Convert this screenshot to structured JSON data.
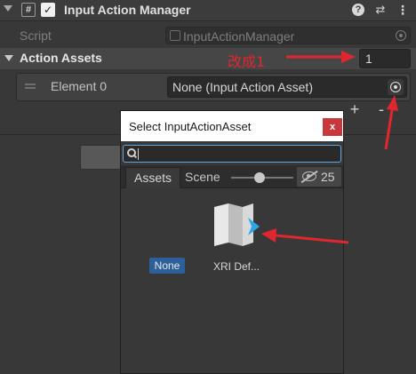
{
  "component": {
    "script_icon": "#",
    "checkbox_mark": "✓",
    "title": "Input Action Manager",
    "help_icon": "?",
    "presets_icon": "⇄",
    "more_icon": "⋮"
  },
  "script_row": {
    "label": "Script",
    "value": "InputActionManager"
  },
  "action_assets": {
    "label": "Action Assets",
    "size": "1",
    "elements": [
      {
        "label": "Element 0",
        "value": "None (Input Action Asset)"
      }
    ],
    "add_label": "+",
    "remove_label": "-"
  },
  "annotation": {
    "text": "改成1",
    "color": "#e0262e"
  },
  "picker": {
    "title": "Select InputActionAsset",
    "close_label": "x",
    "search_value": "",
    "tabs": [
      {
        "label": "Assets",
        "selected": true
      },
      {
        "label": "Scene",
        "selected": false
      }
    ],
    "zoom_level": 0.38,
    "hidden_count": "25",
    "items": [
      {
        "label": "None",
        "selected": true
      },
      {
        "label": "XRI Def...",
        "icon": "input-action-asset-icon",
        "selected": false
      }
    ]
  },
  "colors": {
    "background": "#383838",
    "selection": "#2d5f9a",
    "close_button": "#c8383b",
    "focus_border": "#5fa5e0",
    "annotation": "#e0262e"
  }
}
